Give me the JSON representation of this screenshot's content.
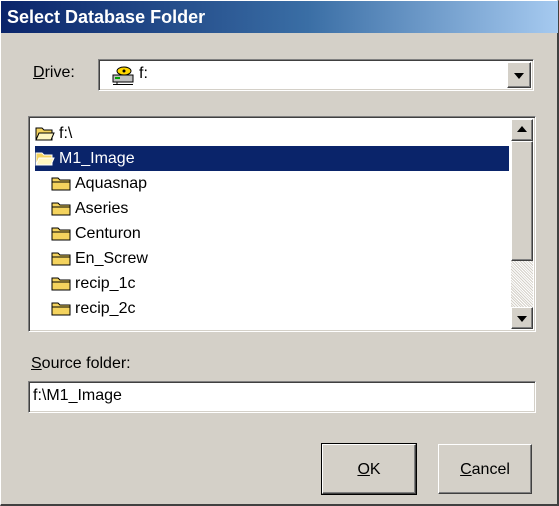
{
  "window": {
    "title": "Select Database Folder"
  },
  "drive": {
    "label_accel": "D",
    "label_rest": "rive:",
    "value": "f:",
    "icon": "network-drive-icon"
  },
  "folder_list": {
    "items": [
      {
        "label": "f:\\",
        "icon": "open-folder-icon",
        "selected": false
      },
      {
        "label": "M1_Image",
        "icon": "open-folder-icon",
        "selected": true
      },
      {
        "label": "Aquasnap",
        "icon": "folder-icon",
        "selected": false
      },
      {
        "label": "Aseries",
        "icon": "folder-icon",
        "selected": false
      },
      {
        "label": "Centuron",
        "icon": "folder-icon",
        "selected": false
      },
      {
        "label": "En_Screw",
        "icon": "folder-icon",
        "selected": false
      },
      {
        "label": "recip_1c",
        "icon": "folder-icon",
        "selected": false
      },
      {
        "label": "recip_2c",
        "icon": "folder-icon",
        "selected": false
      }
    ]
  },
  "source": {
    "label_accel": "S",
    "label_rest": "ource folder:",
    "value": "f:\\M1_Image"
  },
  "buttons": {
    "ok_accel": "O",
    "ok_rest": "K",
    "cancel_accel": "C",
    "cancel_rest": "ancel"
  },
  "colors": {
    "selection": "#0a246a",
    "face": "#d4d0c8",
    "folder": "#f4d35e"
  }
}
